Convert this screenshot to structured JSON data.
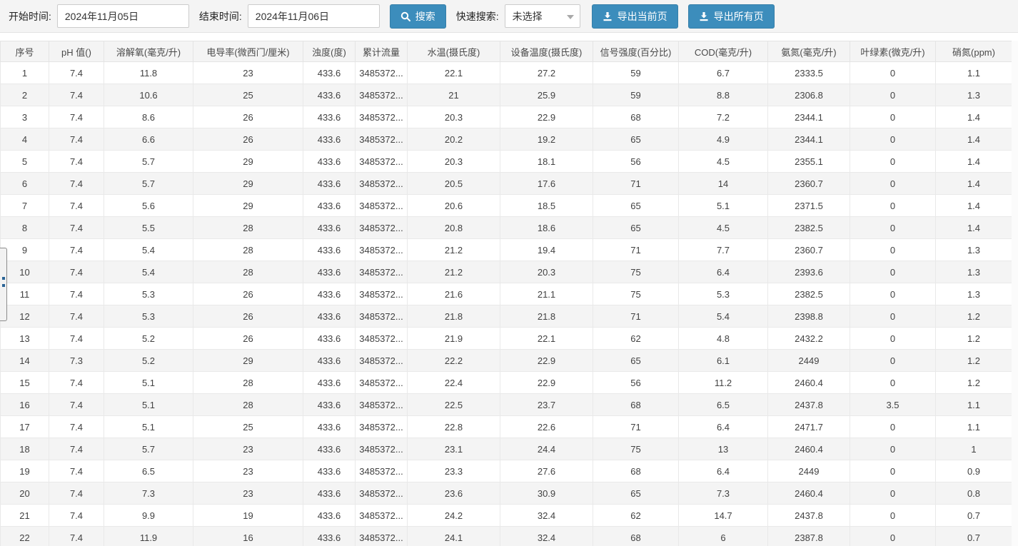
{
  "toolbar": {
    "start_time_label": "开始时间:",
    "start_time_value": "2024年11月05日",
    "end_time_label": "结束时间:",
    "end_time_value": "2024年11月06日",
    "search_button_label": "搜索",
    "quick_search_label": "快速搜索:",
    "quick_search_value": "未选择",
    "export_current_label": "导出当前页",
    "export_all_label": "导出所有页",
    "icons": {
      "search": "search-icon",
      "export_current": "download-icon",
      "export_all": "download-icon",
      "quick_search_caret": "chevron-down-icon"
    }
  },
  "colors": {
    "primary_button": "#3c8dbc",
    "primary_button_border": "#367fa9",
    "toolbar_background": "#f4f4f4",
    "header_row_background": "#f4f4f4",
    "striped_row_background": "#f4f4f4",
    "cell_border": "#e9e9e9",
    "text": "#424242"
  },
  "table": {
    "columns": [
      "序号",
      "pH 值()",
      "溶解氧(毫克/升)",
      "电导率(微西门/厘米)",
      "浊度(度)",
      "累计流量",
      "水温(摄氏度)",
      "设备温度(摄氏度)",
      "信号强度(百分比)",
      "COD(毫克/升)",
      "氨氮(毫克/升)",
      "叶绿素(微克/升)",
      "硝氮(ppm)"
    ],
    "rows": [
      [
        "1",
        "7.4",
        "11.8",
        "23",
        "433.6",
        "3485372...",
        "22.1",
        "27.2",
        "59",
        "6.7",
        "2333.5",
        "0",
        "1.1"
      ],
      [
        "2",
        "7.4",
        "10.6",
        "25",
        "433.6",
        "3485372...",
        "21",
        "25.9",
        "59",
        "8.8",
        "2306.8",
        "0",
        "1.3"
      ],
      [
        "3",
        "7.4",
        "8.6",
        "26",
        "433.6",
        "3485372...",
        "20.3",
        "22.9",
        "68",
        "7.2",
        "2344.1",
        "0",
        "1.4"
      ],
      [
        "4",
        "7.4",
        "6.6",
        "26",
        "433.6",
        "3485372...",
        "20.2",
        "19.2",
        "65",
        "4.9",
        "2344.1",
        "0",
        "1.4"
      ],
      [
        "5",
        "7.4",
        "5.7",
        "29",
        "433.6",
        "3485372...",
        "20.3",
        "18.1",
        "56",
        "4.5",
        "2355.1",
        "0",
        "1.4"
      ],
      [
        "6",
        "7.4",
        "5.7",
        "29",
        "433.6",
        "3485372...",
        "20.5",
        "17.6",
        "71",
        "14",
        "2360.7",
        "0",
        "1.4"
      ],
      [
        "7",
        "7.4",
        "5.6",
        "29",
        "433.6",
        "3485372...",
        "20.6",
        "18.5",
        "65",
        "5.1",
        "2371.5",
        "0",
        "1.4"
      ],
      [
        "8",
        "7.4",
        "5.5",
        "28",
        "433.6",
        "3485372...",
        "20.8",
        "18.6",
        "65",
        "4.5",
        "2382.5",
        "0",
        "1.4"
      ],
      [
        "9",
        "7.4",
        "5.4",
        "28",
        "433.6",
        "3485372...",
        "21.2",
        "19.4",
        "71",
        "7.7",
        "2360.7",
        "0",
        "1.3"
      ],
      [
        "10",
        "7.4",
        "5.4",
        "28",
        "433.6",
        "3485372...",
        "21.2",
        "20.3",
        "75",
        "6.4",
        "2393.6",
        "0",
        "1.3"
      ],
      [
        "11",
        "7.4",
        "5.3",
        "26",
        "433.6",
        "3485372...",
        "21.6",
        "21.1",
        "75",
        "5.3",
        "2382.5",
        "0",
        "1.3"
      ],
      [
        "12",
        "7.4",
        "5.3",
        "26",
        "433.6",
        "3485372...",
        "21.8",
        "21.8",
        "71",
        "5.4",
        "2398.8",
        "0",
        "1.2"
      ],
      [
        "13",
        "7.4",
        "5.2",
        "26",
        "433.6",
        "3485372...",
        "21.9",
        "22.1",
        "62",
        "4.8",
        "2432.2",
        "0",
        "1.2"
      ],
      [
        "14",
        "7.3",
        "5.2",
        "29",
        "433.6",
        "3485372...",
        "22.2",
        "22.9",
        "65",
        "6.1",
        "2449",
        "0",
        "1.2"
      ],
      [
        "15",
        "7.4",
        "5.1",
        "28",
        "433.6",
        "3485372...",
        "22.4",
        "22.9",
        "56",
        "11.2",
        "2460.4",
        "0",
        "1.2"
      ],
      [
        "16",
        "7.4",
        "5.1",
        "28",
        "433.6",
        "3485372...",
        "22.5",
        "23.7",
        "68",
        "6.5",
        "2437.8",
        "3.5",
        "1.1"
      ],
      [
        "17",
        "7.4",
        "5.1",
        "25",
        "433.6",
        "3485372...",
        "22.8",
        "22.6",
        "71",
        "6.4",
        "2471.7",
        "0",
        "1.1"
      ],
      [
        "18",
        "7.4",
        "5.7",
        "23",
        "433.6",
        "3485372...",
        "23.1",
        "24.4",
        "75",
        "13",
        "2460.4",
        "0",
        "1"
      ],
      [
        "19",
        "7.4",
        "6.5",
        "23",
        "433.6",
        "3485372...",
        "23.3",
        "27.6",
        "68",
        "6.4",
        "2449",
        "0",
        "0.9"
      ],
      [
        "20",
        "7.4",
        "7.3",
        "23",
        "433.6",
        "3485372...",
        "23.6",
        "30.9",
        "65",
        "7.3",
        "2460.4",
        "0",
        "0.8"
      ],
      [
        "21",
        "7.4",
        "9.9",
        "19",
        "433.6",
        "3485372...",
        "24.2",
        "32.4",
        "62",
        "14.7",
        "2437.8",
        "0",
        "0.7"
      ],
      [
        "22",
        "7.4",
        "11.9",
        "16",
        "433.6",
        "3485372...",
        "24.1",
        "32.4",
        "68",
        "6",
        "2387.8",
        "0",
        "0.7"
      ]
    ]
  }
}
